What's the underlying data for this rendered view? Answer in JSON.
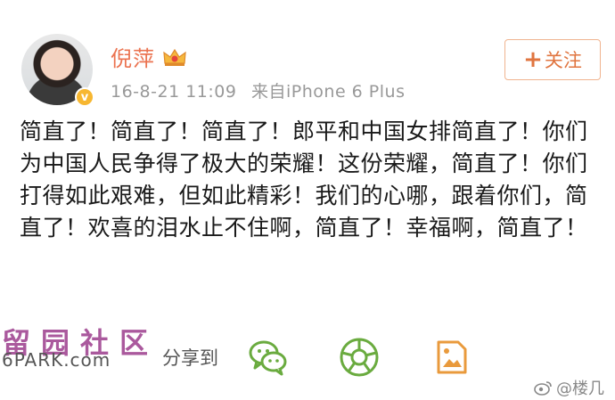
{
  "post": {
    "user_name": "倪萍",
    "timestamp": "16-8-21 11:09",
    "source": "来自iPhone 6 Plus",
    "follow_label": "关注",
    "follow_plus": "+",
    "verified_mark": "v",
    "text": "简直了！简直了！简直了！郎平和中国女排简直了！你们为中国人民争得了极大的荣耀！这份荣耀，简直了！你们打得如此艰难，但如此精彩！我们的心哪，跟着你们，简直了！欢喜的泪水止不住啊，简直了！幸福啊，简直了！"
  },
  "actions": {
    "share_label": "分享到",
    "icons": [
      "wechat-icon",
      "moments-icon",
      "album-icon"
    ]
  },
  "watermark": {
    "cn": "留园社区",
    "en": "6PARK.com"
  },
  "weibo_handle": "@楼几",
  "colors": {
    "name": "#eb7350",
    "follow_border": "#f0b48f",
    "icon_green": "#6aab3f",
    "icon_orange": "#e99a3c",
    "meta_gray": "#999999"
  }
}
